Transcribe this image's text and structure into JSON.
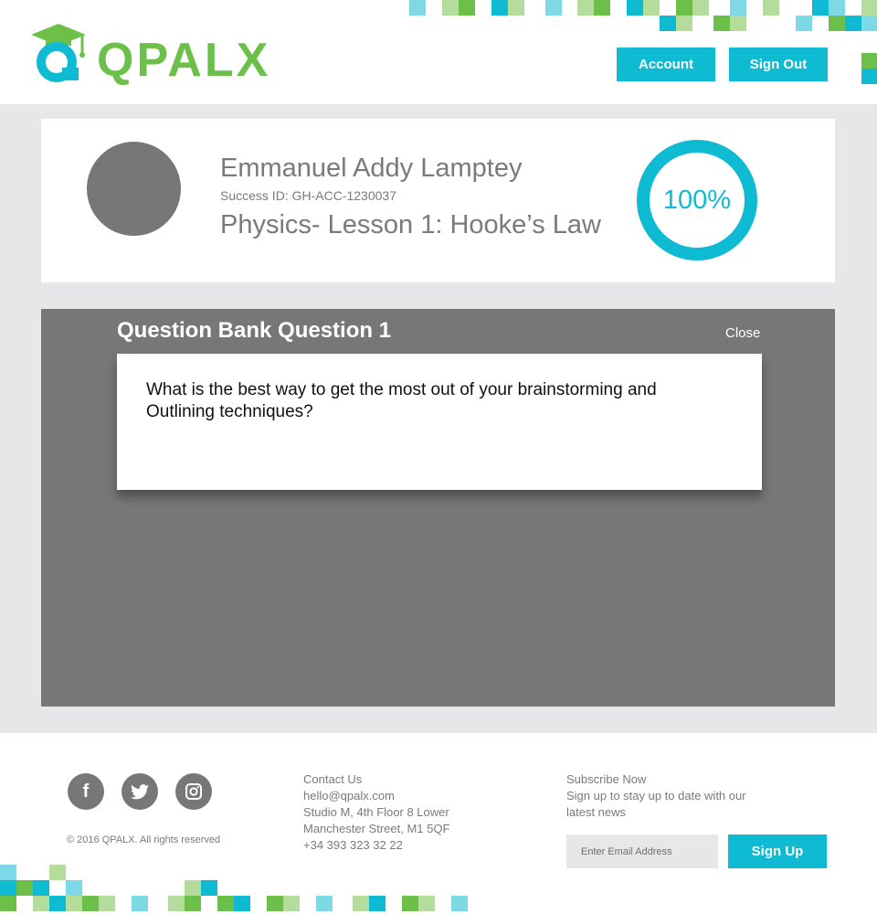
{
  "header": {
    "logo_text": "QPALX",
    "account_label": "Account",
    "signout_label": "Sign Out",
    "colors": {
      "brand_green": "#6cc04a",
      "brand_cyan": "#0fbad3"
    }
  },
  "profile": {
    "name": "Emmanuel Addy Lamptey",
    "success_id": "Success ID: GH-ACC-1230037",
    "lesson": "Physics- Lesson 1: Hooke’s Law",
    "progress_label": "100%",
    "progress_value": 1.0
  },
  "question": {
    "heading": "Question Bank Question 1",
    "close_label": "Close",
    "text": "What is the best way to get the most out of your brainstorming and Outlining techniques?"
  },
  "footer": {
    "copyright": "© 2016 QPALX. All rights reserved",
    "social": [
      "facebook-icon",
      "twitter-icon",
      "instagram-icon"
    ],
    "contact": {
      "title": "Contact Us",
      "email": "hello@qpalx.com",
      "address_1": "Studio M, 4th Floor 8 Lower",
      "address_2": "Manchester Street, M1 5QF",
      "phone": "+34 393 323 32 22"
    },
    "subscribe": {
      "title": "Subscribe Now",
      "description": "Sign up to stay up to date with our latest news",
      "email_placeholder": "Enter Email Address",
      "signup_label": "Sign Up"
    }
  }
}
